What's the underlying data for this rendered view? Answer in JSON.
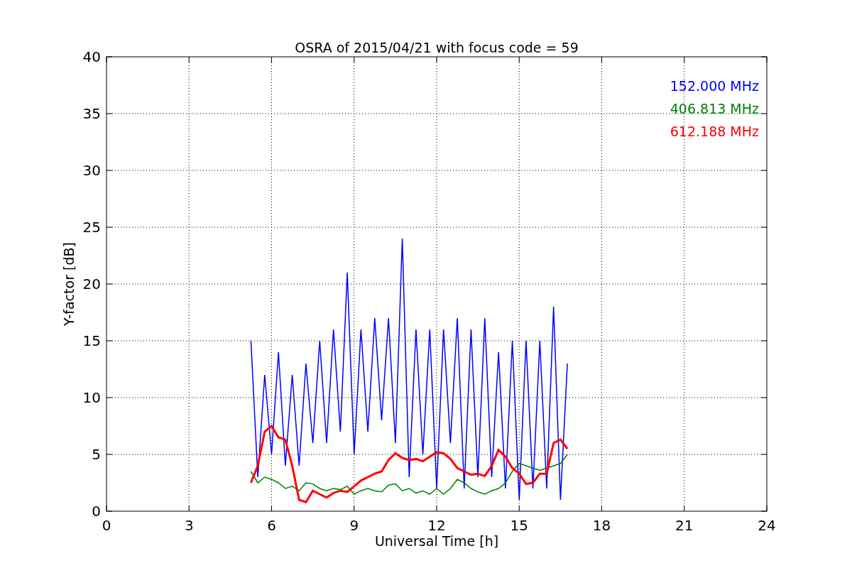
{
  "figure": {
    "chart_data": {
      "type": "line",
      "title": "OSRA of 2015/04/21 with focus code = 59",
      "xlabel": "Universal Time [h]",
      "ylabel": "Y-factor [dB]",
      "x": [
        5.25,
        5.5,
        5.75,
        6,
        6.25,
        6.5,
        6.75,
        7,
        7.25,
        7.5,
        7.75,
        8,
        8.25,
        8.5,
        8.75,
        9,
        9.25,
        9.5,
        9.75,
        10,
        10.25,
        10.5,
        10.75,
        11,
        11.25,
        11.5,
        11.75,
        12,
        12.25,
        12.5,
        12.75,
        13,
        13.25,
        13.5,
        13.75,
        14,
        14.25,
        14.5,
        14.75,
        15,
        15.25,
        15.5,
        15.75,
        16,
        16.25,
        16.5,
        16.75
      ],
      "series": [
        {
          "name": "152.000 MHz",
          "color": "#0000ff",
          "values": [
            15,
            3,
            12,
            5,
            14,
            4,
            12,
            4,
            13,
            6,
            15,
            6,
            16,
            7,
            21,
            5,
            16,
            7,
            17,
            8,
            17,
            6,
            24,
            3,
            16,
            5,
            16,
            2,
            16,
            6,
            17,
            2,
            16,
            3,
            17,
            3,
            14,
            2,
            15,
            1,
            15,
            2,
            15,
            2,
            18,
            1,
            13
          ]
        },
        {
          "name": "406.813 MHz",
          "color": "#008000",
          "values": [
            3.5,
            2.5,
            3,
            2.8,
            2.5,
            2,
            2.2,
            1.8,
            2.5,
            2.4,
            2,
            1.8,
            2,
            1.9,
            2.2,
            1.5,
            1.8,
            2,
            1.8,
            1.7,
            2.3,
            2.4,
            1.8,
            2,
            1.6,
            1.8,
            1.5,
            2,
            1.5,
            2,
            2.8,
            2.5,
            2,
            1.7,
            1.5,
            1.8,
            2,
            2.5,
            3.5,
            4.2,
            4,
            3.8,
            3.6,
            3.8,
            4,
            4.2,
            5
          ]
        },
        {
          "name": "612.188 MHz",
          "color": "#ff0000",
          "values": [
            2.5,
            4,
            7,
            7.5,
            6.5,
            6.3,
            4,
            1,
            0.8,
            1.8,
            1.5,
            1.2,
            1.6,
            1.8,
            1.7,
            2.2,
            2.7,
            3,
            3.3,
            3.5,
            4.5,
            5.1,
            4.7,
            4.5,
            4.6,
            4.4,
            4.8,
            5.2,
            5.1,
            4.6,
            3.8,
            3.5,
            3.2,
            3.3,
            3.1,
            4,
            5.4,
            4.8,
            3.8,
            3.3,
            2.4,
            2.5,
            3.3,
            3.3,
            6,
            6.3,
            5.5
          ]
        }
      ],
      "xlim": [
        0,
        24
      ],
      "ylim": [
        0,
        40
      ],
      "xticks": [
        0,
        3,
        6,
        9,
        12,
        15,
        18,
        21,
        24
      ],
      "yticks": [
        0,
        5,
        10,
        15,
        20,
        25,
        30,
        35,
        40
      ],
      "grid": true
    }
  }
}
